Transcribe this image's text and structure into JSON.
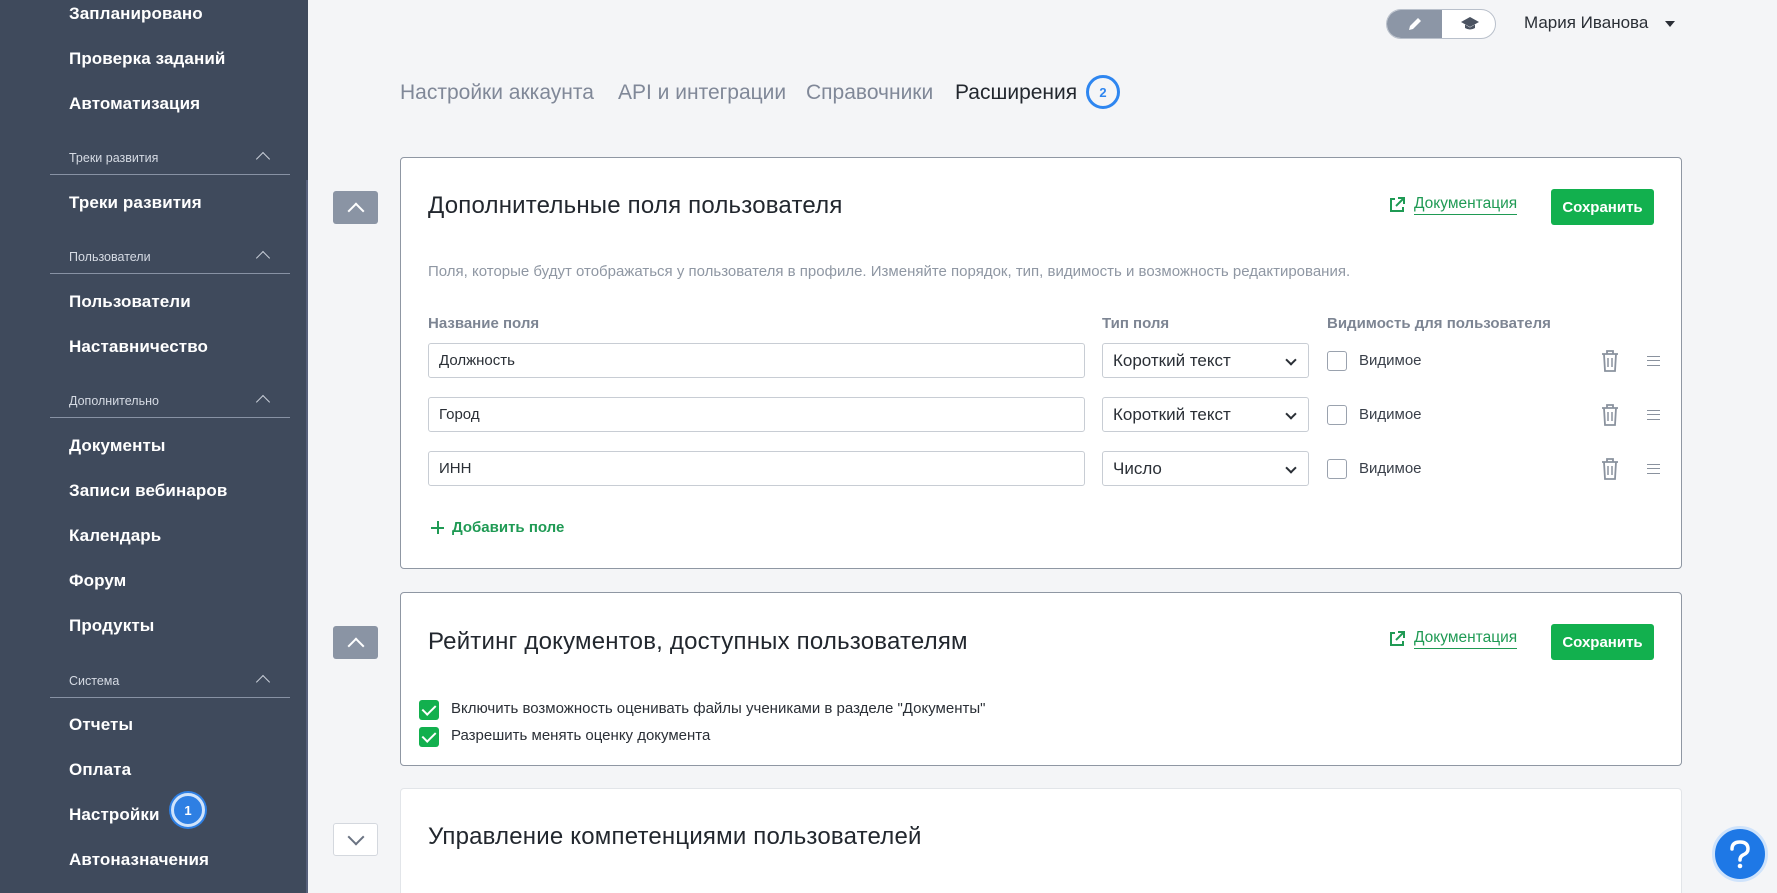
{
  "sidebar": {
    "items_top": [
      {
        "label": "Запланировано"
      },
      {
        "label": "Проверка заданий"
      },
      {
        "label": "Автоматизация"
      }
    ],
    "sections": [
      {
        "label": "Треки развития",
        "items": [
          "Треки развития"
        ]
      },
      {
        "label": "Пользователи",
        "items": [
          "Пользователи",
          "Наставничество"
        ]
      },
      {
        "label": "Дополнительно",
        "items": [
          "Документы",
          "Записи вебинаров",
          "Календарь",
          "Форум",
          "Продукты"
        ]
      },
      {
        "label": "Система",
        "items": [
          "Отчеты",
          "Оплата",
          "Настройки",
          "Автоназначения"
        ]
      }
    ],
    "settings_badge": "1"
  },
  "header": {
    "user_name": "Мария Иванова",
    "mode_icons": [
      "pencil-icon",
      "graduation-cap-icon"
    ]
  },
  "tabs": [
    {
      "label": "Настройки аккаунта",
      "active": false
    },
    {
      "label": "API и интеграции",
      "active": false
    },
    {
      "label": "Справочники",
      "active": false
    },
    {
      "label": "Расширения",
      "active": true
    }
  ],
  "tab_badge": "2",
  "card1": {
    "title": "Дополнительные поля пользователя",
    "doc_link": "Документация",
    "save_label": "Сохранить",
    "description": "Поля, которые будут отображаться у пользователя в профиле. Изменяйте порядок, тип, видимость и возможность редактирования.",
    "columns": {
      "name": "Название поля",
      "type": "Тип поля",
      "visibility": "Видимость для пользователя"
    },
    "rows": [
      {
        "name": "Должность",
        "type": "Короткий текст",
        "visible_label": "Видимое",
        "visible": false
      },
      {
        "name": "Город",
        "type": "Короткий текст",
        "visible_label": "Видимое",
        "visible": false
      },
      {
        "name": "ИНН",
        "type": "Число",
        "visible_label": "Видимое",
        "visible": false
      }
    ],
    "add_field_label": "Добавить поле"
  },
  "card2": {
    "title": "Рейтинг документов, доступных пользователям",
    "doc_link": "Документация",
    "save_label": "Сохранить",
    "options": [
      {
        "label": "Включить возможность оценивать файлы учениками в разделе \"Документы\"",
        "checked": true
      },
      {
        "label": "Разрешить менять оценку документа",
        "checked": true
      }
    ]
  },
  "card3": {
    "title": "Управление компетенциями пользователей"
  },
  "help_icon": "question-icon",
  "colors": {
    "sidebar": "#3f4a5c",
    "accent_green": "#12b04e",
    "badge_blue": "#2e86f0"
  }
}
